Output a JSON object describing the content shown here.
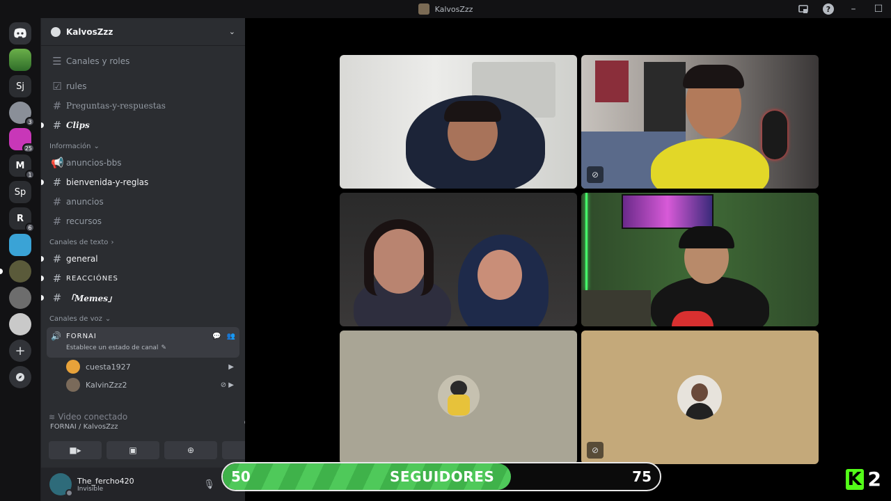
{
  "window": {
    "title": "KalvosZzz"
  },
  "servers": [
    {
      "label": "",
      "badge": ""
    },
    {
      "label": "",
      "badge": ""
    },
    {
      "label": "Sj",
      "badge": ""
    },
    {
      "label": "",
      "badge": "3"
    },
    {
      "label": "",
      "badge": "25"
    },
    {
      "label": "M",
      "badge": "1"
    },
    {
      "label": "Sp",
      "badge": ""
    },
    {
      "label": "R",
      "badge": "6"
    },
    {
      "label": "",
      "badge": ""
    },
    {
      "label": "",
      "badge": ""
    },
    {
      "label": "",
      "badge": ""
    },
    {
      "label": "",
      "badge": ""
    }
  ],
  "guild": {
    "name": "KalvosZzz"
  },
  "channels": {
    "roles": "Canales y roles",
    "top": [
      "rules",
      "Preguntas-y-respuestas",
      "Clips"
    ],
    "cat_info": "Información",
    "info": [
      "anuncios-bbs",
      "bienvenida-y-reglas",
      "anuncios",
      "recursos"
    ],
    "cat_text": "Canales de texto",
    "text": [
      "general",
      "REACCIÓNES",
      "「Memes」"
    ],
    "cat_voice": "Canales de voz",
    "voice_name": "FORNAI",
    "voice_status": "Establece un estado de canal",
    "voice_users": [
      "cuesta1927",
      "KalvinZzz2"
    ]
  },
  "rtc": {
    "status": "Video conectado",
    "channel": "FORNAI / KalvosZzz"
  },
  "user": {
    "name": "The_fercho420",
    "status": "Invisible"
  },
  "progress": {
    "start": "50",
    "label": "SEGUIDORES",
    "end": "75",
    "fill_pct": 66
  },
  "kick": {
    "letter": "K",
    "count": "2"
  }
}
